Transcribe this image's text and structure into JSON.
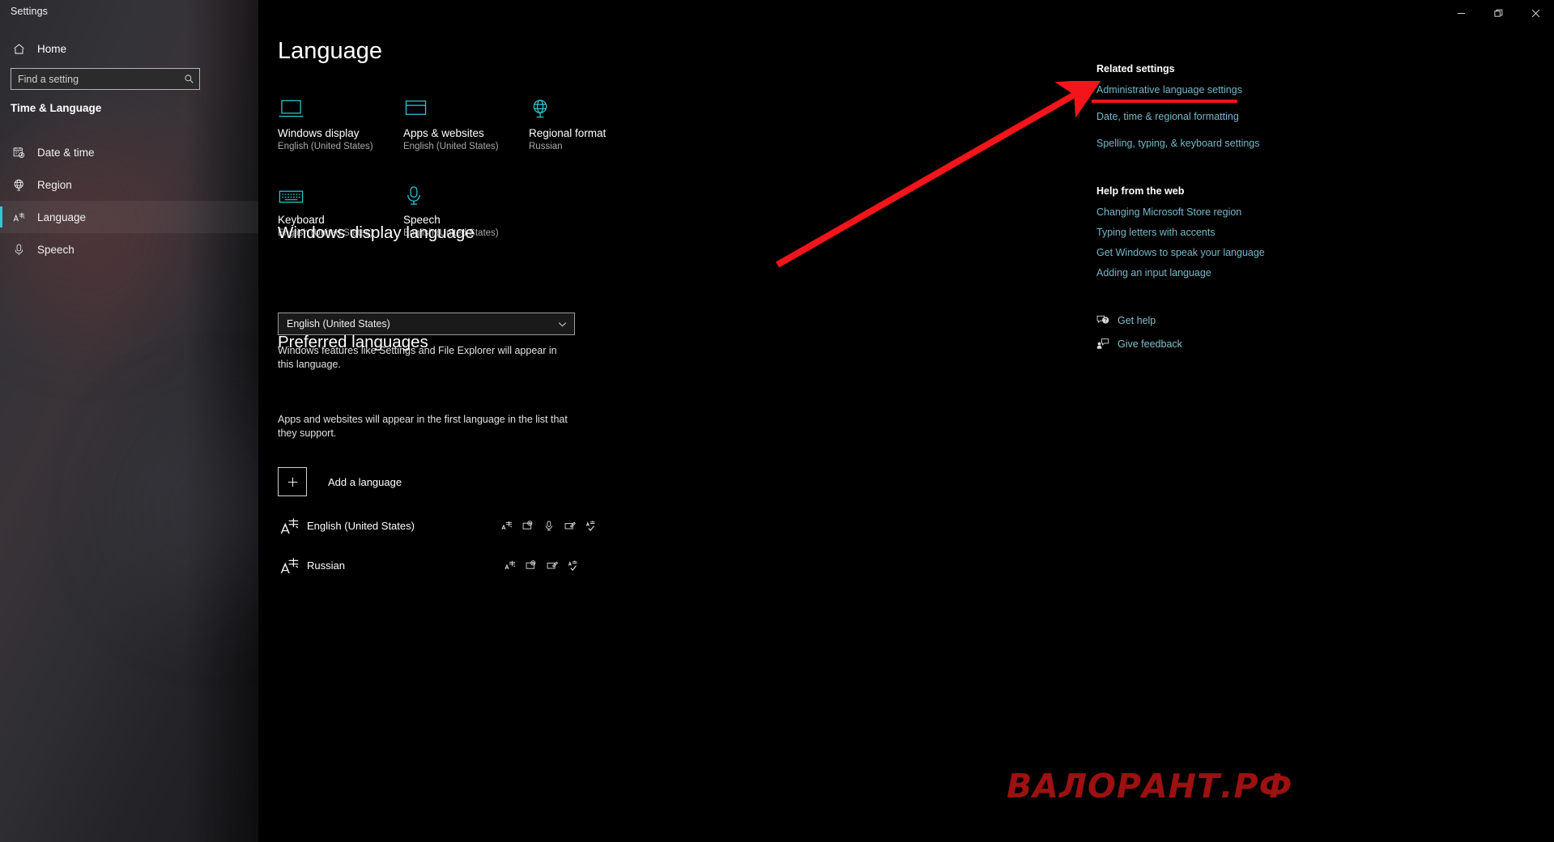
{
  "window": {
    "app_title": "Settings",
    "controls": [
      {
        "name": "minimize",
        "glyph": "minimize-icon"
      },
      {
        "name": "restore",
        "glyph": "restore-icon"
      },
      {
        "name": "close",
        "glyph": "close-icon"
      }
    ]
  },
  "theme": {
    "accent": "#2ec8d4",
    "link": "#75b8c8",
    "annotation_red": "#f4151b",
    "watermark_red": "#9c1111",
    "background": "#000000",
    "sidebar_background": "#2e2e33"
  },
  "sidebar": {
    "home_label": "Home",
    "home_icon": "home-icon",
    "search": {
      "placeholder": "Find a setting",
      "value": "",
      "icon": "search-icon"
    },
    "category_title": "Time & Language",
    "items": [
      {
        "label": "Date & time",
        "icon": "calendar-clock-icon",
        "selected": false
      },
      {
        "label": "Region",
        "icon": "globe-icon",
        "selected": false
      },
      {
        "label": "Language",
        "icon": "language-a-icon",
        "selected": true
      },
      {
        "label": "Speech",
        "icon": "microphone-icon",
        "selected": false
      }
    ]
  },
  "main": {
    "page_title": "Language",
    "tiles": [
      {
        "name": "Windows display",
        "value": "English (United States)",
        "icon": "laptop-icon"
      },
      {
        "name": "Apps & websites",
        "value": "English (United States)",
        "icon": "window-icon"
      },
      {
        "name": "Regional format",
        "value": "Russian",
        "icon": "globe-stand-icon"
      },
      {
        "name": "Keyboard",
        "value": "English (United States)",
        "icon": "keyboard-icon"
      },
      {
        "name": "Speech",
        "value": "English (United States)",
        "icon": "microphone-icon"
      }
    ],
    "display_language": {
      "heading": "Windows display language",
      "selected": "English (United States)",
      "chevron_icon": "chevron-down-icon",
      "description": "Windows features like Settings and File Explorer will appear in this language."
    },
    "preferred_languages": {
      "heading": "Preferred languages",
      "description": "Apps and websites will appear in the first language in the list that they support.",
      "add_label": "Add a language",
      "add_icon": "plus-icon",
      "rows": [
        {
          "name": "English (United States)",
          "icon": "language-a-icon",
          "features": [
            "language-pack-icon",
            "text-to-speech-icon",
            "speech-recognition-icon",
            "handwriting-icon",
            "spellcheck-icon"
          ]
        },
        {
          "name": "Russian",
          "icon": "language-a-icon",
          "features": [
            "language-pack-icon",
            "text-to-speech-icon",
            "handwriting-icon",
            "spellcheck-icon"
          ]
        }
      ]
    }
  },
  "rail": {
    "related_settings_heading": "Related settings",
    "related_links": [
      "Administrative language settings",
      "Date, time & regional formatting",
      "Spelling, typing, & keyboard settings"
    ],
    "help_heading": "Help from the web",
    "help_links": [
      "Changing Microsoft Store region",
      "Typing letters with accents",
      "Get Windows to speak your language",
      "Adding an input language"
    ],
    "footer": [
      {
        "label": "Get help",
        "icon": "help-bubble-icon"
      },
      {
        "label": "Give feedback",
        "icon": "feedback-icon"
      }
    ]
  },
  "annotation": {
    "underline_target": "Administrative language settings",
    "arrow": "red-arrow-pointing-up-right"
  },
  "watermark": {
    "text": "ВАЛОРАНТ.РФ"
  }
}
